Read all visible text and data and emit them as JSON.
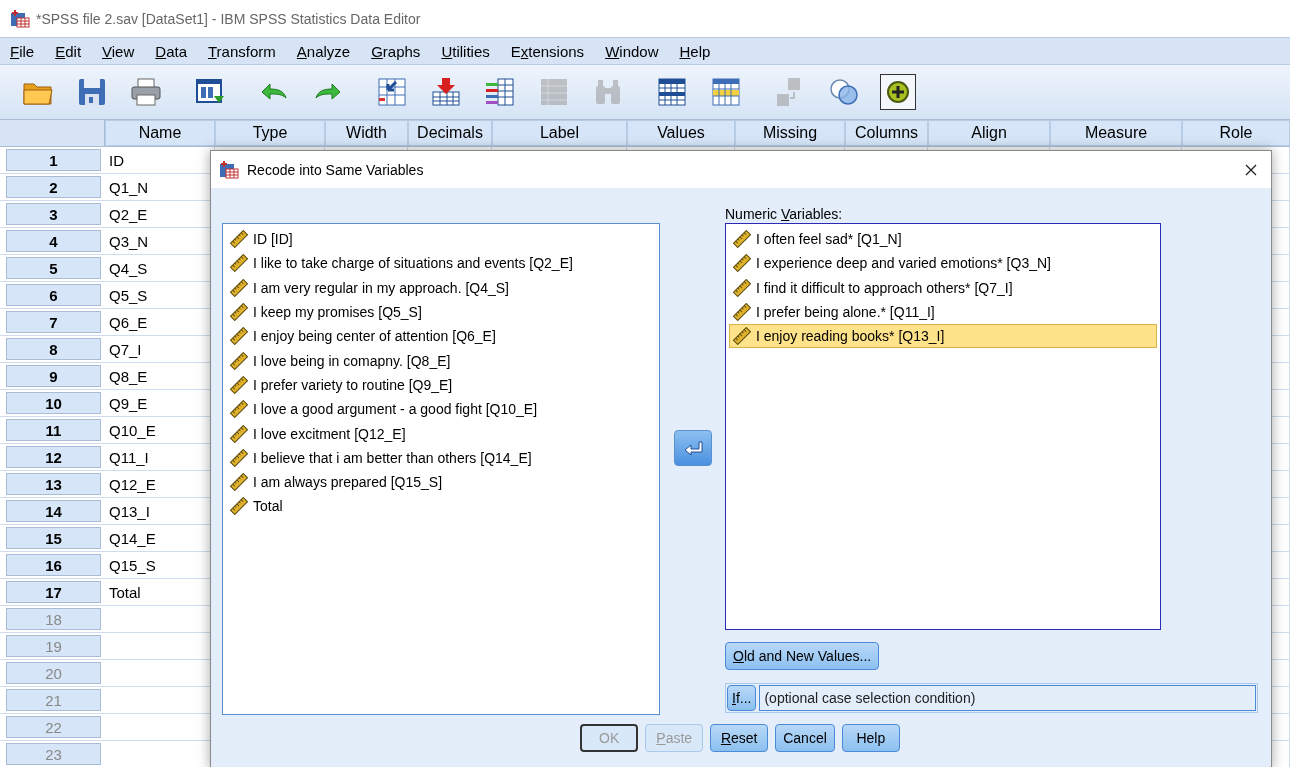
{
  "window": {
    "title": "*SPSS file 2.sav [DataSet1] - IBM SPSS Statistics Data Editor"
  },
  "menu": [
    {
      "key": "F",
      "post": "ile"
    },
    {
      "key": "E",
      "post": "dit"
    },
    {
      "key": "V",
      "post": "iew"
    },
    {
      "key": "D",
      "post": "ata"
    },
    {
      "key": "T",
      "post": "ransform"
    },
    {
      "key": "A",
      "post": "nalyze"
    },
    {
      "key": "G",
      "post": "raphs"
    },
    {
      "key": "U",
      "post": "tilities"
    },
    {
      "pre": "E",
      "key": "x",
      "post": "tensions"
    },
    {
      "key": "W",
      "post": "indow"
    },
    {
      "key": "H",
      "post": "elp"
    }
  ],
  "toolbar": [
    [
      {
        "kind": "open",
        "disabled": false,
        "pressed": false
      },
      {
        "kind": "save",
        "disabled": false,
        "pressed": false
      },
      {
        "kind": "print",
        "disabled": false,
        "pressed": false
      }
    ],
    [
      {
        "kind": "recall",
        "disabled": false,
        "pressed": false
      }
    ],
    [
      {
        "kind": "undo",
        "disabled": false,
        "pressed": false
      },
      {
        "kind": "redo",
        "disabled": false,
        "pressed": false
      }
    ],
    [
      {
        "kind": "goto",
        "disabled": false,
        "pressed": false
      },
      {
        "kind": "insert-down",
        "disabled": false,
        "pressed": false
      },
      {
        "kind": "variables",
        "disabled": false,
        "pressed": false
      },
      {
        "kind": "grid",
        "disabled": true,
        "pressed": false
      },
      {
        "kind": "find",
        "disabled": true,
        "pressed": false
      }
    ],
    [
      {
        "kind": "table",
        "disabled": false,
        "pressed": false
      },
      {
        "kind": "table-yellow",
        "disabled": false,
        "pressed": false
      }
    ],
    [
      {
        "kind": "value-labels",
        "disabled": true,
        "pressed": false
      },
      {
        "kind": "circles",
        "disabled": false,
        "pressed": false
      },
      {
        "kind": "plus",
        "disabled": false,
        "pressed": true
      }
    ]
  ],
  "grid": {
    "columns": [
      "Name",
      "Type",
      "Width",
      "Decimals",
      "Label",
      "Values",
      "Missing",
      "Columns",
      "Align",
      "Measure",
      "Role"
    ],
    "rows": [
      {
        "number": "1",
        "name": "ID",
        "dimmed": false
      },
      {
        "number": "2",
        "name": "Q1_N",
        "dimmed": false
      },
      {
        "number": "3",
        "name": "Q2_E",
        "dimmed": false
      },
      {
        "number": "4",
        "name": "Q3_N",
        "dimmed": false
      },
      {
        "number": "5",
        "name": "Q4_S",
        "dimmed": false
      },
      {
        "number": "6",
        "name": "Q5_S",
        "dimmed": false
      },
      {
        "number": "7",
        "name": "Q6_E",
        "dimmed": false
      },
      {
        "number": "8",
        "name": "Q7_I",
        "dimmed": false
      },
      {
        "number": "9",
        "name": "Q8_E",
        "dimmed": false
      },
      {
        "number": "10",
        "name": "Q9_E",
        "dimmed": false
      },
      {
        "number": "11",
        "name": "Q10_E",
        "dimmed": false
      },
      {
        "number": "12",
        "name": "Q11_I",
        "dimmed": false
      },
      {
        "number": "13",
        "name": "Q12_E",
        "dimmed": false
      },
      {
        "number": "14",
        "name": "Q13_I",
        "dimmed": false
      },
      {
        "number": "15",
        "name": "Q14_E",
        "dimmed": false
      },
      {
        "number": "16",
        "name": "Q15_S",
        "dimmed": false
      },
      {
        "number": "17",
        "name": "Total",
        "dimmed": false
      },
      {
        "number": "18",
        "dimmed": true
      },
      {
        "number": "19",
        "dimmed": true
      },
      {
        "number": "20",
        "dimmed": true
      },
      {
        "number": "21",
        "dimmed": true
      },
      {
        "number": "22",
        "dimmed": true
      },
      {
        "number": "23",
        "dimmed": true
      }
    ]
  },
  "dialog": {
    "title": "Recode into Same Variables",
    "source_list": [
      {
        "label": "ID [ID]",
        "selected": false
      },
      {
        "label": "I like to take charge of situations and events [Q2_E]",
        "selected": false
      },
      {
        "label": "I am very regular in my approach. [Q4_S]",
        "selected": false
      },
      {
        "label": "I keep my promises [Q5_S]",
        "selected": false
      },
      {
        "label": "I enjoy being center of attention [Q6_E]",
        "selected": false
      },
      {
        "label": "I love being in comapny. [Q8_E]",
        "selected": false
      },
      {
        "label": "I prefer variety to routine [Q9_E]",
        "selected": false
      },
      {
        "label": "I love a good argument - a good fight [Q10_E]",
        "selected": false
      },
      {
        "label": "I love excitment [Q12_E]",
        "selected": false
      },
      {
        "label": "I believe that i am better than others  [Q14_E]",
        "selected": false
      },
      {
        "label": "I am always prepared [Q15_S]",
        "selected": false
      },
      {
        "label": "Total",
        "selected": false
      }
    ],
    "target_label": {
      "pre": "Numeric ",
      "key": "V",
      "post": "ariables:"
    },
    "target_list": [
      {
        "label": "I often feel sad* [Q1_N]",
        "selected": false
      },
      {
        "label": "I experience deep and varied emotions* [Q3_N]",
        "selected": false
      },
      {
        "label": "I find it difficult to approach others* [Q7_I]",
        "selected": false
      },
      {
        "label": "I prefer being alone.* [Q11_I]",
        "selected": false
      },
      {
        "label": "I enjoy reading books* [Q13_I]",
        "selected": true
      }
    ],
    "old_new_button": {
      "key": "O",
      "post": "ld and New Values..."
    },
    "if_button": {
      "key": "I",
      "post": "f..."
    },
    "condition": {
      "placeholder": "(optional case selection condition)"
    },
    "buttons": [
      {
        "label": "OK",
        "disabled": true,
        "default": true
      },
      {
        "key": "P",
        "post": "aste",
        "disabled": true,
        "default": false
      },
      {
        "key": "R",
        "post": "eset",
        "disabled": false,
        "default": false
      },
      {
        "label": "Cancel",
        "disabled": false,
        "default": false
      },
      {
        "label": "Help",
        "disabled": false,
        "default": false
      }
    ]
  }
}
